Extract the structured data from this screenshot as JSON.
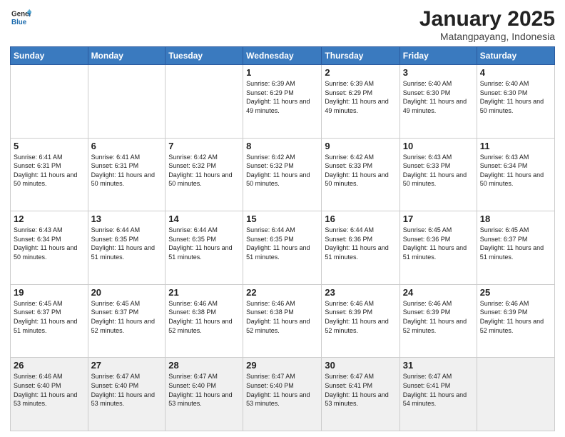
{
  "header": {
    "logo_line1": "General",
    "logo_line2": "Blue",
    "month": "January 2025",
    "location": "Matangpayang, Indonesia"
  },
  "days_of_week": [
    "Sunday",
    "Monday",
    "Tuesday",
    "Wednesday",
    "Thursday",
    "Friday",
    "Saturday"
  ],
  "weeks": [
    [
      {
        "day": "",
        "info": ""
      },
      {
        "day": "",
        "info": ""
      },
      {
        "day": "",
        "info": ""
      },
      {
        "day": "1",
        "info": "Sunrise: 6:39 AM\nSunset: 6:29 PM\nDaylight: 11 hours\nand 49 minutes."
      },
      {
        "day": "2",
        "info": "Sunrise: 6:39 AM\nSunset: 6:29 PM\nDaylight: 11 hours\nand 49 minutes."
      },
      {
        "day": "3",
        "info": "Sunrise: 6:40 AM\nSunset: 6:30 PM\nDaylight: 11 hours\nand 49 minutes."
      },
      {
        "day": "4",
        "info": "Sunrise: 6:40 AM\nSunset: 6:30 PM\nDaylight: 11 hours\nand 50 minutes."
      }
    ],
    [
      {
        "day": "5",
        "info": "Sunrise: 6:41 AM\nSunset: 6:31 PM\nDaylight: 11 hours\nand 50 minutes."
      },
      {
        "day": "6",
        "info": "Sunrise: 6:41 AM\nSunset: 6:31 PM\nDaylight: 11 hours\nand 50 minutes."
      },
      {
        "day": "7",
        "info": "Sunrise: 6:42 AM\nSunset: 6:32 PM\nDaylight: 11 hours\nand 50 minutes."
      },
      {
        "day": "8",
        "info": "Sunrise: 6:42 AM\nSunset: 6:32 PM\nDaylight: 11 hours\nand 50 minutes."
      },
      {
        "day": "9",
        "info": "Sunrise: 6:42 AM\nSunset: 6:33 PM\nDaylight: 11 hours\nand 50 minutes."
      },
      {
        "day": "10",
        "info": "Sunrise: 6:43 AM\nSunset: 6:33 PM\nDaylight: 11 hours\nand 50 minutes."
      },
      {
        "day": "11",
        "info": "Sunrise: 6:43 AM\nSunset: 6:34 PM\nDaylight: 11 hours\nand 50 minutes."
      }
    ],
    [
      {
        "day": "12",
        "info": "Sunrise: 6:43 AM\nSunset: 6:34 PM\nDaylight: 11 hours\nand 50 minutes."
      },
      {
        "day": "13",
        "info": "Sunrise: 6:44 AM\nSunset: 6:35 PM\nDaylight: 11 hours\nand 51 minutes."
      },
      {
        "day": "14",
        "info": "Sunrise: 6:44 AM\nSunset: 6:35 PM\nDaylight: 11 hours\nand 51 minutes."
      },
      {
        "day": "15",
        "info": "Sunrise: 6:44 AM\nSunset: 6:35 PM\nDaylight: 11 hours\nand 51 minutes."
      },
      {
        "day": "16",
        "info": "Sunrise: 6:44 AM\nSunset: 6:36 PM\nDaylight: 11 hours\nand 51 minutes."
      },
      {
        "day": "17",
        "info": "Sunrise: 6:45 AM\nSunset: 6:36 PM\nDaylight: 11 hours\nand 51 minutes."
      },
      {
        "day": "18",
        "info": "Sunrise: 6:45 AM\nSunset: 6:37 PM\nDaylight: 11 hours\nand 51 minutes."
      }
    ],
    [
      {
        "day": "19",
        "info": "Sunrise: 6:45 AM\nSunset: 6:37 PM\nDaylight: 11 hours\nand 51 minutes."
      },
      {
        "day": "20",
        "info": "Sunrise: 6:45 AM\nSunset: 6:37 PM\nDaylight: 11 hours\nand 52 minutes."
      },
      {
        "day": "21",
        "info": "Sunrise: 6:46 AM\nSunset: 6:38 PM\nDaylight: 11 hours\nand 52 minutes."
      },
      {
        "day": "22",
        "info": "Sunrise: 6:46 AM\nSunset: 6:38 PM\nDaylight: 11 hours\nand 52 minutes."
      },
      {
        "day": "23",
        "info": "Sunrise: 6:46 AM\nSunset: 6:39 PM\nDaylight: 11 hours\nand 52 minutes."
      },
      {
        "day": "24",
        "info": "Sunrise: 6:46 AM\nSunset: 6:39 PM\nDaylight: 11 hours\nand 52 minutes."
      },
      {
        "day": "25",
        "info": "Sunrise: 6:46 AM\nSunset: 6:39 PM\nDaylight: 11 hours\nand 52 minutes."
      }
    ],
    [
      {
        "day": "26",
        "info": "Sunrise: 6:46 AM\nSunset: 6:40 PM\nDaylight: 11 hours\nand 53 minutes."
      },
      {
        "day": "27",
        "info": "Sunrise: 6:47 AM\nSunset: 6:40 PM\nDaylight: 11 hours\nand 53 minutes."
      },
      {
        "day": "28",
        "info": "Sunrise: 6:47 AM\nSunset: 6:40 PM\nDaylight: 11 hours\nand 53 minutes."
      },
      {
        "day": "29",
        "info": "Sunrise: 6:47 AM\nSunset: 6:40 PM\nDaylight: 11 hours\nand 53 minutes."
      },
      {
        "day": "30",
        "info": "Sunrise: 6:47 AM\nSunset: 6:41 PM\nDaylight: 11 hours\nand 53 minutes."
      },
      {
        "day": "31",
        "info": "Sunrise: 6:47 AM\nSunset: 6:41 PM\nDaylight: 11 hours\nand 54 minutes."
      },
      {
        "day": "",
        "info": ""
      }
    ]
  ]
}
